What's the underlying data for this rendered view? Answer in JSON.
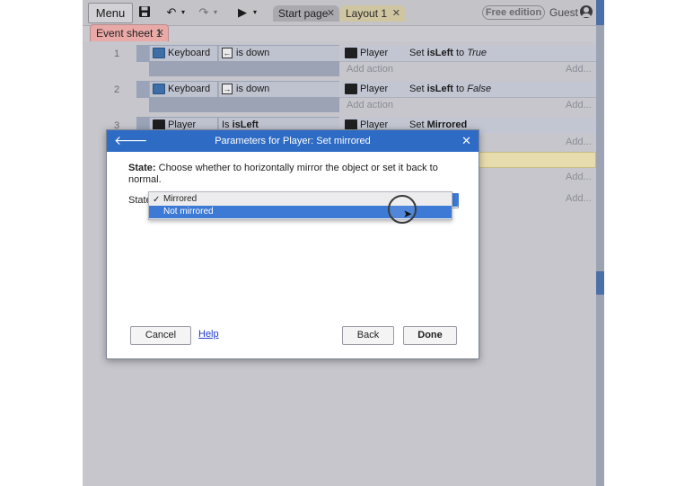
{
  "toolbar": {
    "menu_label": "Menu",
    "icons": [
      "save-icon",
      "undo-icon",
      "redo-icon",
      "play-icon"
    ],
    "dropdown_glyph": "▾"
  },
  "tabs": [
    {
      "label": "Start page"
    },
    {
      "label": "Layout 1"
    }
  ],
  "edition_badge": "Free edition",
  "user": {
    "label": "Guest"
  },
  "sheet_tab": {
    "label": "Event sheet 1"
  },
  "events": [
    {
      "number": "1",
      "cond_object": "Keyboard",
      "cond_arrow": "←",
      "cond_text": "is down",
      "act_object": "Player",
      "act_prefix": "Set ",
      "act_var": "isLeft",
      "act_mid": " to ",
      "act_value": "True"
    },
    {
      "number": "2",
      "cond_object": "Keyboard",
      "cond_arrow": "→",
      "cond_text": "is down",
      "act_object": "Player",
      "act_prefix": "Set ",
      "act_var": "isLeft",
      "act_mid": " to ",
      "act_value": "False"
    },
    {
      "number": "3",
      "cond_object": "Player",
      "cond_prefix": "Is ",
      "cond_var": "isLeft",
      "act_object": "Player",
      "act_prefix": "Set ",
      "act_var": "Mirrored"
    }
  ],
  "add_action_label": "Add action",
  "add_more_label": "Add...",
  "dialog": {
    "title": "Parameters for Player: Set mirrored",
    "desc_label": "State:",
    "desc_text": " Choose whether to horizontally mirror the object or set it back to normal.",
    "param_label": "State",
    "options": [
      "Mirrored",
      "Not mirrored"
    ],
    "checked_option": "Mirrored",
    "highlighted_option": "Not mirrored",
    "check_glyph": "✓",
    "buttons": {
      "cancel": "Cancel",
      "help": "Help",
      "back": "Back",
      "done": "Done"
    }
  },
  "colors": {
    "dialog_titlebar": "#2d6bc4",
    "selection": "#3d7ad6",
    "event_sheet_tab": "#e8a9a7",
    "layout_tab": "#cfc5a1",
    "help_link": "#1f3ccf"
  }
}
